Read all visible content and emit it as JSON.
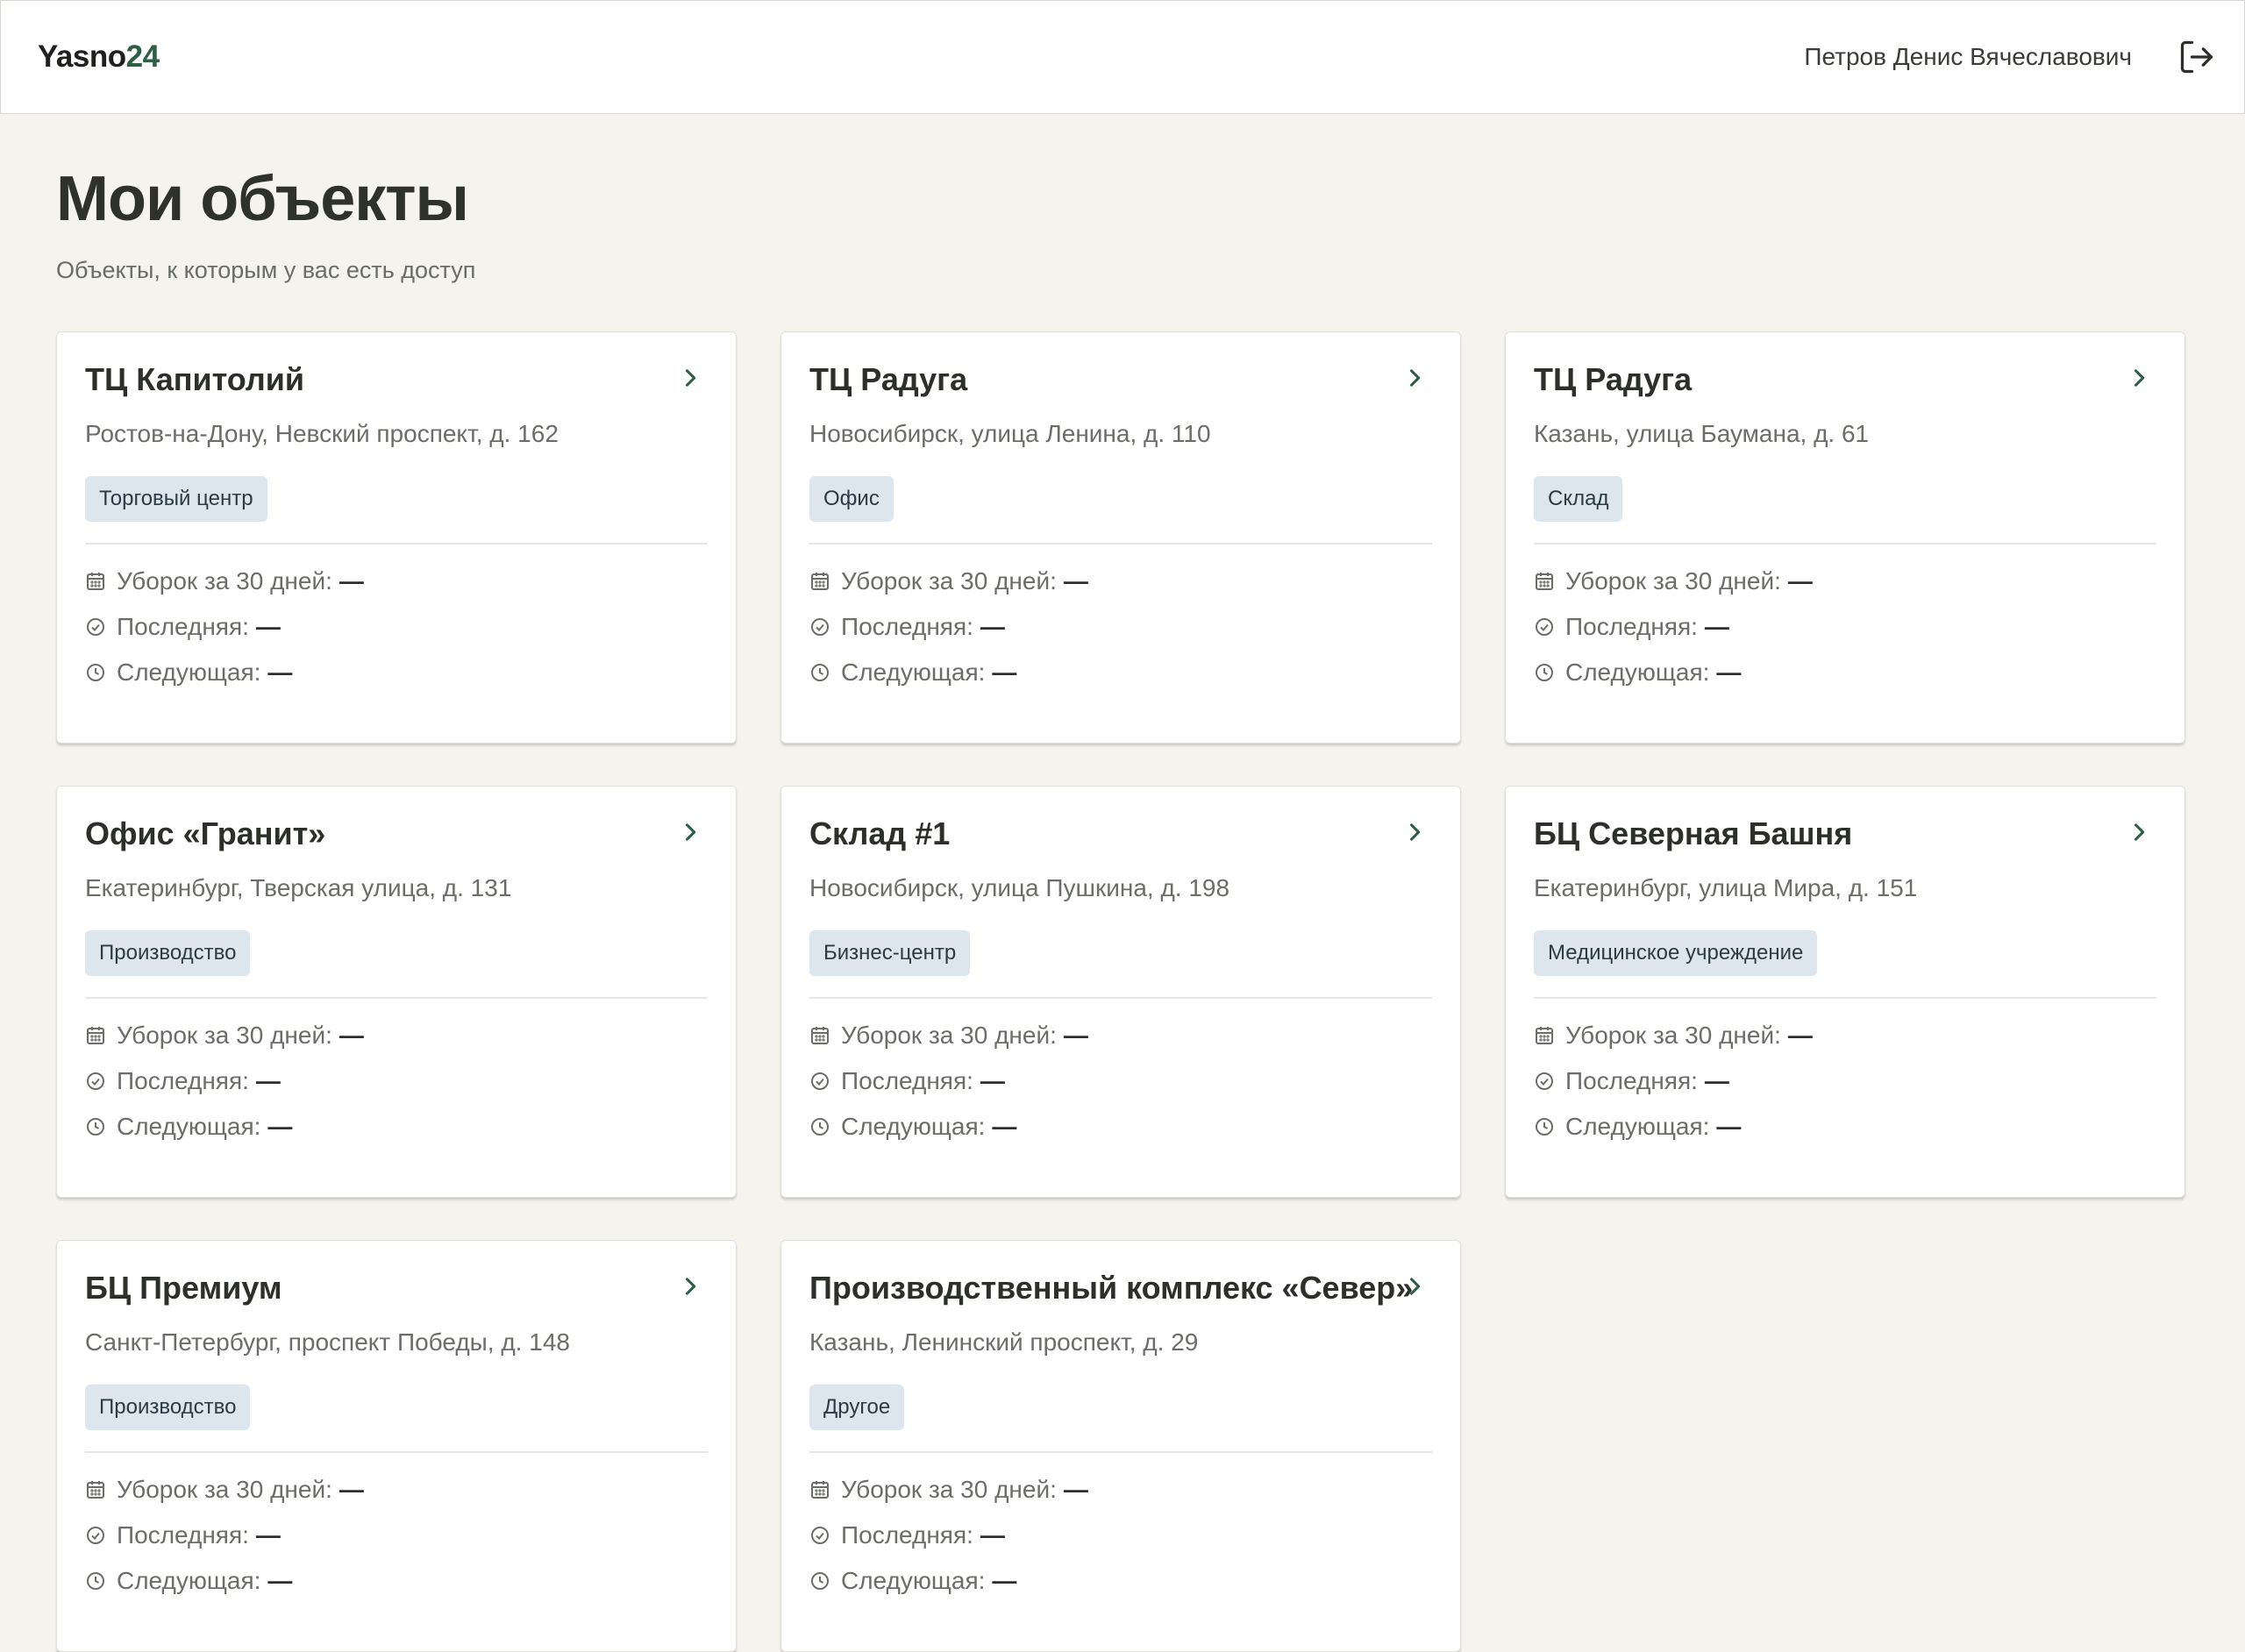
{
  "header": {
    "logo_text": "Yasno",
    "logo_accent": "24",
    "user_name": "Петров Денис Вячеславович",
    "logout_icon": "logout-icon"
  },
  "page": {
    "title": "Мои объекты",
    "subtitle": "Объекты, к которым у вас есть доступ"
  },
  "stat_labels": {
    "cleanings": "Уборок за 30 дней:",
    "last": "Последняя:",
    "next": "Следующая:"
  },
  "colors": {
    "background": "#f5f3ed",
    "accent": "#2f5e45",
    "tag_bg": "#dde6ee"
  },
  "objects": [
    {
      "title": "ТЦ Капитолий",
      "address": "Ростов-на-Дону, Невский проспект, д. 162",
      "tag": "Торговый центр",
      "cleanings": "—",
      "last": "—",
      "next": "—"
    },
    {
      "title": "ТЦ Радуга",
      "address": "Новосибирск, улица Ленина, д. 110",
      "tag": "Офис",
      "cleanings": "—",
      "last": "—",
      "next": "—"
    },
    {
      "title": "ТЦ Радуга",
      "address": "Казань, улица Баумана, д. 61",
      "tag": "Склад",
      "cleanings": "—",
      "last": "—",
      "next": "—"
    },
    {
      "title": "Офис «Гранит»",
      "address": "Екатеринбург, Тверская улица, д. 131",
      "tag": "Производство",
      "cleanings": "—",
      "last": "—",
      "next": "—"
    },
    {
      "title": "Склад #1",
      "address": "Новосибирск, улица Пушкина, д. 198",
      "tag": "Бизнес-центр",
      "cleanings": "—",
      "last": "—",
      "next": "—"
    },
    {
      "title": "БЦ Северная Башня",
      "address": "Екатеринбург, улица Мира, д. 151",
      "tag": "Медицинское учреждение",
      "cleanings": "—",
      "last": "—",
      "next": "—"
    },
    {
      "title": "БЦ Премиум",
      "address": "Санкт-Петербург, проспект Победы, д. 148",
      "tag": "Производство",
      "cleanings": "—",
      "last": "—",
      "next": "—"
    },
    {
      "title": "Производственный комплекс «Север»",
      "address": "Казань, Ленинский проспект, д. 29",
      "tag": "Другое",
      "cleanings": "—",
      "last": "—",
      "next": "—"
    }
  ]
}
